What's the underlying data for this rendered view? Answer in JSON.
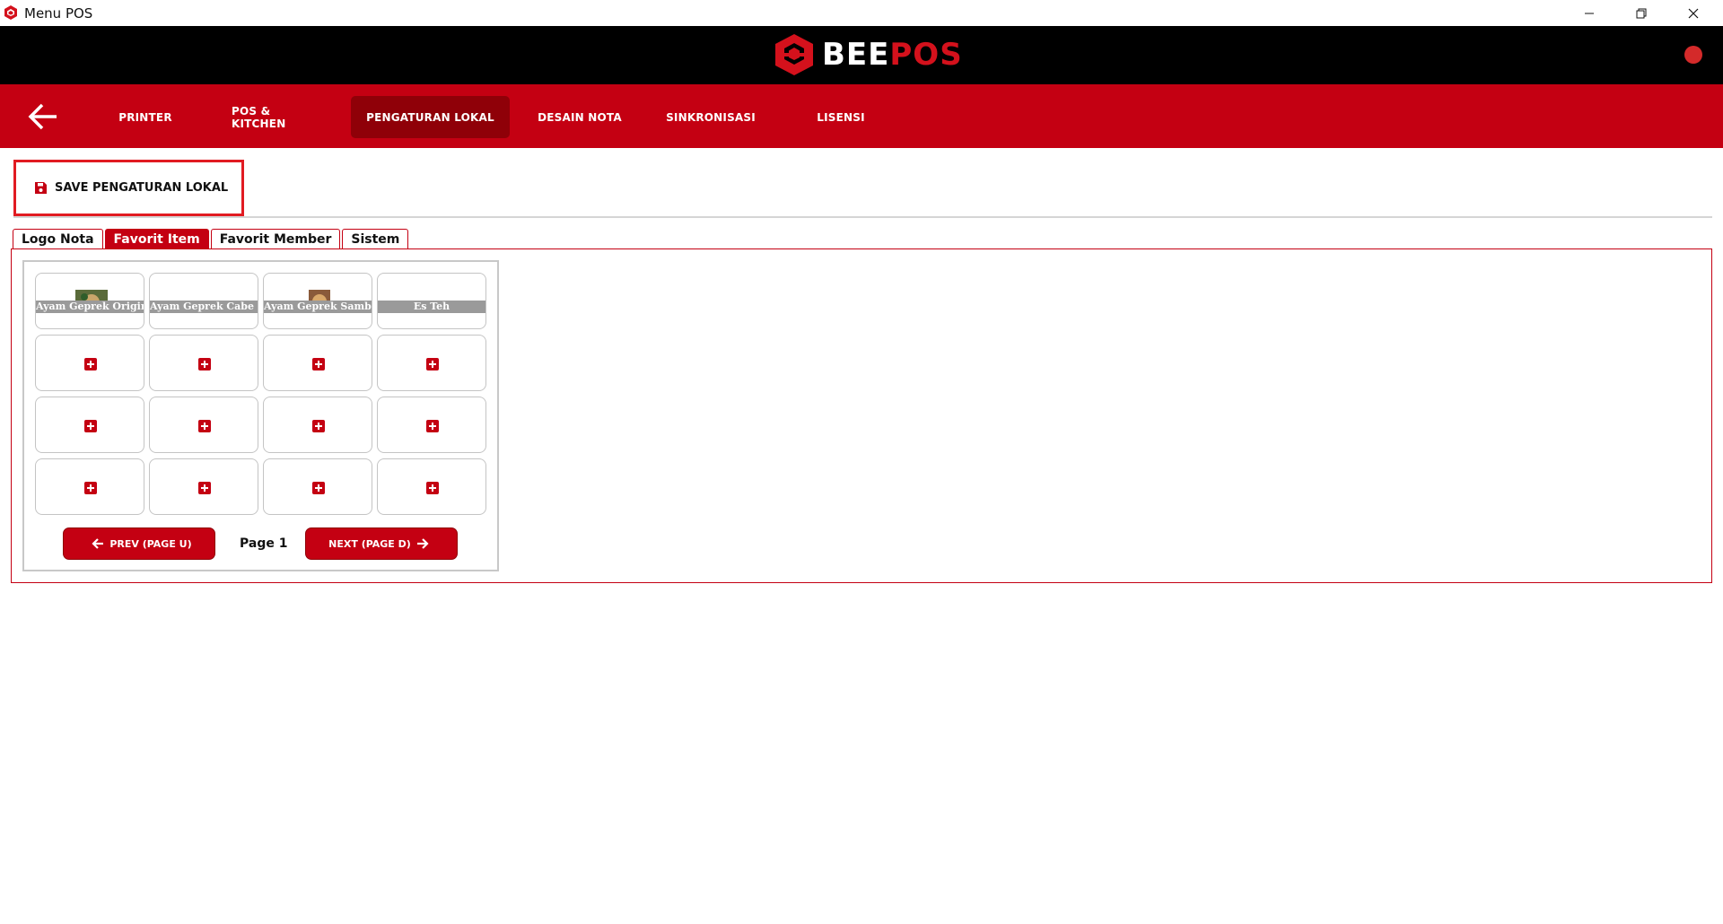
{
  "window": {
    "title": "Menu POS"
  },
  "brand": {
    "part1": "BEE",
    "part2": "POS"
  },
  "nav": {
    "tabs": [
      {
        "label": "PRINTER"
      },
      {
        "label": "POS & KITCHEN"
      },
      {
        "label": "PENGATURAN LOKAL",
        "active": true
      },
      {
        "label": "DESAIN NOTA"
      },
      {
        "label": "SINKRONISASI"
      },
      {
        "label": "LISENSI"
      }
    ]
  },
  "toolbar": {
    "save_label": "SAVE PENGATURAN LOKAL"
  },
  "tabs": [
    {
      "label": "Logo Nota"
    },
    {
      "label": "Favorit Item",
      "active": true
    },
    {
      "label": "Favorit Member"
    },
    {
      "label": "Sistem"
    }
  ],
  "favorites": {
    "items": [
      {
        "label": "Ayam Geprek Original",
        "has_image": true
      },
      {
        "label": "Ayam Geprek Cabe Ijo",
        "has_image": false
      },
      {
        "label": "Ayam Geprek Sambal Matah",
        "has_image": true
      },
      {
        "label": "Es Teh",
        "has_image": false
      }
    ],
    "empty_slots": 12
  },
  "pager": {
    "prev_label": "PREV (PAGE U)",
    "next_label": "NEXT (PAGE D)",
    "page_label": "Page 1"
  },
  "colors": {
    "primary": "#c40012",
    "primary_dark": "#8f0008",
    "brand_black": "#000000"
  }
}
